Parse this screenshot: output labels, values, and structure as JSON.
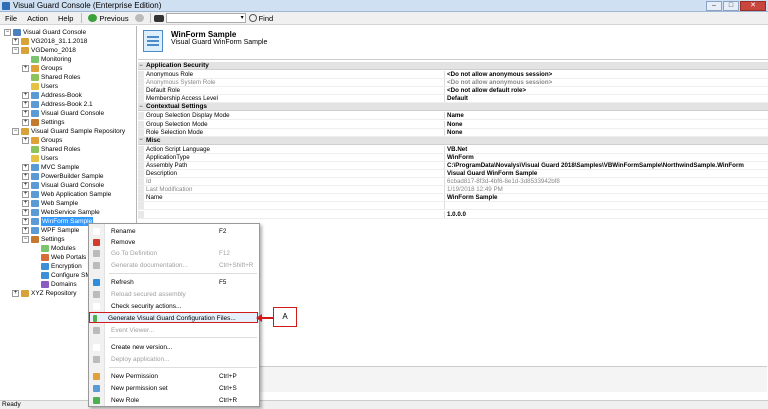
{
  "window": {
    "title": "Visual Guard Console (Enterprise Edition)",
    "buttons": [
      "–",
      "□",
      "✕"
    ]
  },
  "menubar": {
    "items": [
      "File",
      "Action",
      "Help"
    ],
    "previous": "Previous",
    "find": "Find"
  },
  "tree": {
    "items": [
      {
        "label": "Visual Guard Console",
        "expander": "−",
        "icon_color": "#4a7fc0"
      },
      {
        "label": "VG2018_31.1.2018",
        "expander": "+",
        "icon_color": "#d8a23a"
      },
      {
        "label": "VGDemo_2018",
        "expander": "−",
        "icon_color": "#d8a23a"
      },
      {
        "label": "Monitoring",
        "expander": "",
        "icon_color": "#7cc56f"
      },
      {
        "label": "Groups",
        "expander": "+",
        "icon_color": "#e0a03a"
      },
      {
        "label": "Shared Roles",
        "expander": "",
        "icon_color": "#8dc35b"
      },
      {
        "label": "Users",
        "expander": "",
        "icon_color": "#e6c244"
      },
      {
        "label": "Address-Book",
        "expander": "+",
        "icon_color": "#5b9bd5"
      },
      {
        "label": "Address-Book 2.1",
        "expander": "+",
        "icon_color": "#5b9bd5"
      },
      {
        "label": "Visual Guard Console",
        "expander": "+",
        "icon_color": "#5b9bd5"
      },
      {
        "label": "Settings",
        "expander": "+",
        "icon_color": "#c47a2c"
      },
      {
        "label": "Visual Guard Sample Repository",
        "expander": "−",
        "icon_color": "#d8a23a"
      },
      {
        "label": "Groups",
        "expander": "+",
        "icon_color": "#e0a03a"
      },
      {
        "label": "Shared Roles",
        "expander": "",
        "icon_color": "#8dc35b"
      },
      {
        "label": "Users",
        "expander": "",
        "icon_color": "#e6c244"
      },
      {
        "label": "MVC Sample",
        "expander": "+",
        "icon_color": "#5b9bd5"
      },
      {
        "label": "PowerBuilder Sample",
        "expander": "+",
        "icon_color": "#5b9bd5"
      },
      {
        "label": "Visual Guard Console",
        "expander": "+",
        "icon_color": "#5b9bd5"
      },
      {
        "label": "Web Application Sample",
        "expander": "+",
        "icon_color": "#5b9bd5"
      },
      {
        "label": "Web Sample",
        "expander": "+",
        "icon_color": "#5b9bd5"
      },
      {
        "label": "WebService Sample",
        "expander": "+",
        "icon_color": "#5b9bd5"
      },
      {
        "label": "WinForm Sample",
        "expander": "+",
        "icon_color": "#5b9bd5",
        "selected": true
      },
      {
        "label": "WPF Sample",
        "expander": "+",
        "icon_color": "#5b9bd5"
      },
      {
        "label": "Settings",
        "expander": "−",
        "icon_color": "#c47a2c"
      },
      {
        "label": "Modules",
        "expander": "",
        "icon_color": "#7cc56f"
      },
      {
        "label": "Web Portals",
        "expander": "",
        "icon_color": "#d86b3a"
      },
      {
        "label": "Encryption",
        "expander": "",
        "icon_color": "#3a8fd8"
      },
      {
        "label": "Configure SM",
        "expander": "",
        "icon_color": "#3a8fd8"
      },
      {
        "label": "Domains",
        "expander": "",
        "icon_color": "#8a5cc2"
      },
      {
        "label": "XYZ Repository",
        "expander": "+",
        "icon_color": "#d8a23a"
      }
    ]
  },
  "header": {
    "title": "WinForm Sample",
    "subtitle": "Visual Guard WinForm Sample"
  },
  "grid": {
    "categories": [
      "Application Security",
      "Contextual Settings",
      "Misc"
    ],
    "security": [
      {
        "name": "Anonymous Role",
        "value": "<Do not allow anonymous session>"
      },
      {
        "name": "Anonymous System Role",
        "value": "<Do not allow anonymous session>",
        "dim": true
      },
      {
        "name": "Default Role",
        "value": "<Do not allow default role>"
      },
      {
        "name": "Membership Access Level",
        "value": "Default"
      }
    ],
    "contextual": [
      {
        "name": "Group Selection Display Mode",
        "value": "Name"
      },
      {
        "name": "Group Selection Mode",
        "value": "None"
      },
      {
        "name": "Role Selection Mode",
        "value": "None"
      }
    ],
    "misc": [
      {
        "name": "Action Script Language",
        "value": "VB.Net"
      },
      {
        "name": "ApplicationType",
        "value": "WinForm"
      },
      {
        "name": "Assembly Path",
        "value": "C:\\ProgramData\\Novalys\\Visual Guard 2018\\Samples\\VBWinFormSample\\NorthwindSample.WinForm"
      },
      {
        "name": "Description",
        "value": "Visual Guard WinForm Sample"
      },
      {
        "name": "Id",
        "value": "6cbad817-8f3d-4bf6-8e1d-3d8533942bf8",
        "dim": true
      },
      {
        "name": "Last Modification",
        "value": "1/19/2018 12:49 PM",
        "dim": true
      },
      {
        "name": "Name",
        "value": "WinForm Sample"
      },
      {
        "name": "",
        "value": ""
      },
      {
        "name": "",
        "value": "1.0.0.0"
      }
    ]
  },
  "context_menu": {
    "items": [
      {
        "label": "Rename",
        "key": "F2",
        "icon": "rename-icon",
        "color": "#ffffff"
      },
      {
        "label": "Remove",
        "key": "",
        "icon": "remove-icon",
        "color": "#d33b2c"
      },
      {
        "label": "Go To Definition",
        "key": "F12",
        "icon": "goto-icon",
        "color": "#bbbbbb",
        "disabled": true
      },
      {
        "label": "Generate documentation...",
        "key": "Ctrl+Shift+R",
        "icon": "doc-icon",
        "color": "#bbbbbb",
        "disabled": true
      },
      {
        "label": "Refresh",
        "key": "F5",
        "icon": "refresh-icon",
        "color": "#2f8de0"
      },
      {
        "label": "Reload secured assembly",
        "key": "",
        "icon": "reload-icon",
        "color": "#bbbbbb",
        "disabled": true
      },
      {
        "label": "Check security actions...",
        "key": "",
        "icon": "check-icon",
        "color": "#ffffff"
      },
      {
        "label": "Generate Visual Guard Configuration Files...",
        "key": "",
        "icon": "generate-icon",
        "color": "#4caf50",
        "highlight": true
      },
      {
        "label": "Event Viewer...",
        "key": "",
        "icon": "event-icon",
        "color": "#bbbbbb",
        "disabled": true
      },
      {
        "label": "Create new version...",
        "key": "",
        "icon": "version-icon",
        "color": "#ffffff"
      },
      {
        "label": "Deploy application...",
        "key": "",
        "icon": "deploy-icon",
        "color": "#bbbbbb",
        "disabled": true
      },
      {
        "label": "New Permission",
        "key": "Ctrl+P",
        "icon": "permission-icon",
        "color": "#e0a03a"
      },
      {
        "label": "New permission set",
        "key": "Ctrl+S",
        "icon": "permset-icon",
        "color": "#5b9bd5"
      },
      {
        "label": "New Role",
        "key": "Ctrl+R",
        "icon": "role-icon",
        "color": "#4caf50"
      }
    ]
  },
  "callout": {
    "label": "A"
  },
  "status": {
    "text": "Ready"
  }
}
